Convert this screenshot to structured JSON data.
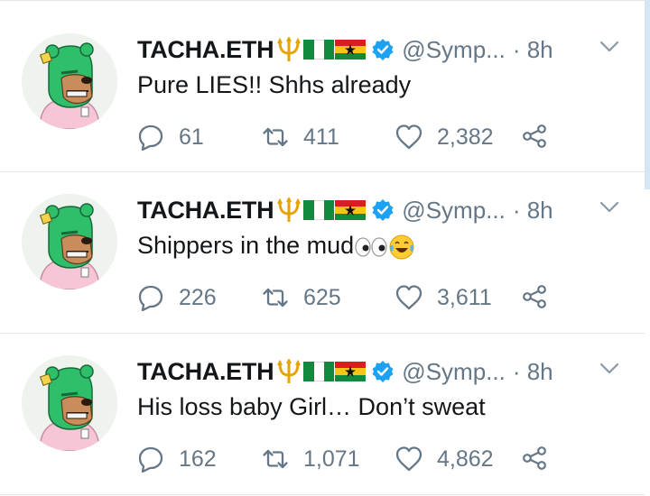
{
  "tweets": [
    {
      "name": "TACHA.ETH",
      "trident": "444",
      "handle": "@Symp...",
      "time": "· 8h",
      "text": "Pure LIES!! Shhs already",
      "emoji": "",
      "replies": "61",
      "retweets": "411",
      "likes": "2,382"
    },
    {
      "name": "TACHA.ETH",
      "handle": "@Symp...",
      "time": "· 8h",
      "text": "Shippers in the mud",
      "emoji": "eyes-laugh",
      "replies": "226",
      "retweets": "625",
      "likes": "3,611"
    },
    {
      "name": "TACHA.ETH",
      "handle": "@Symp...",
      "time": "· 8h",
      "text": "His loss baby Girl… Don’t sweat",
      "emoji": "",
      "replies": "162",
      "retweets": "1,071",
      "likes": "4,862"
    }
  ],
  "icons": {
    "reply": "reply-icon",
    "retweet": "retweet-icon",
    "like": "heart-icon",
    "share": "share-icon",
    "verified": "verified-badge-icon",
    "caret": "chevron-down-icon",
    "trident": "trident-icon",
    "flag_nigeria": "nigeria-flag-icon",
    "flag_ghana": "ghana-flag-icon"
  },
  "colors": {
    "verified": "#1da1f2",
    "secondary_text": "#657786",
    "avatar_green": "#2fbf6b"
  }
}
